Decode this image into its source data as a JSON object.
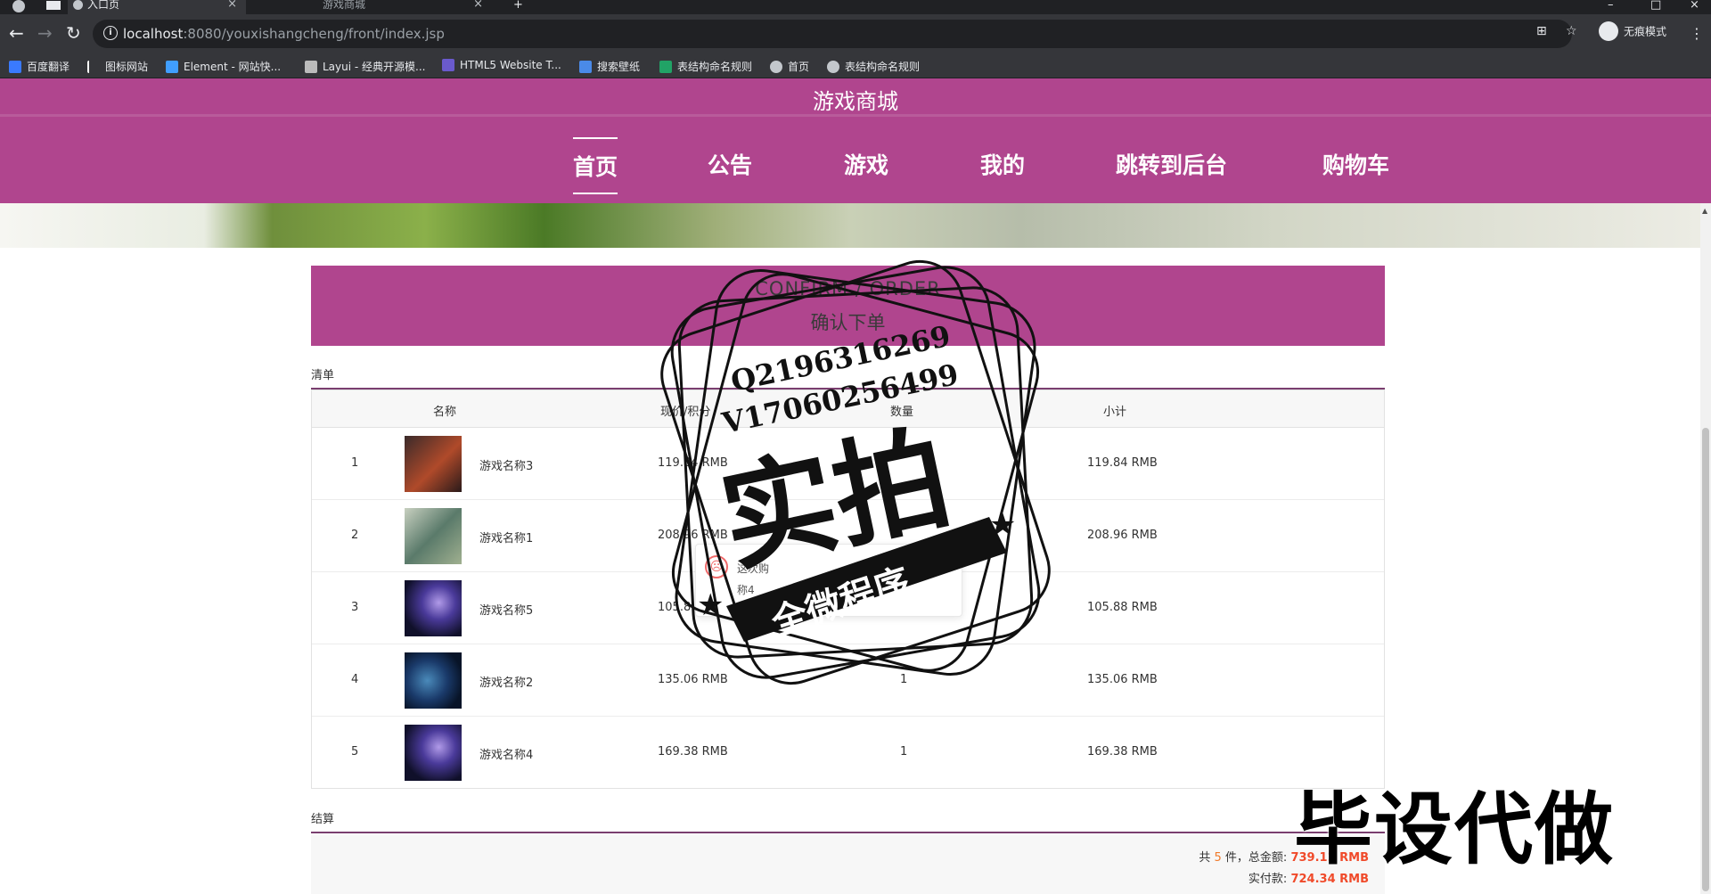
{
  "browser": {
    "tabs": [
      {
        "label": "入口页",
        "active": true
      },
      {
        "label": "游戏商城",
        "active": false
      }
    ],
    "url_host": "localhost",
    "url_rest": ":8080/youxishangcheng/front/index.jsp",
    "profile_label": "无痕模式",
    "bookmarks": [
      {
        "label": "百度翻译",
        "color": "#3a7afe"
      },
      {
        "label": "图标网站",
        "color": "#ffffff"
      },
      {
        "label": "Element - 网站快...",
        "color": "#409eff"
      },
      {
        "label": "Layui - 经典开源模...",
        "color": "#bbbbbb"
      },
      {
        "label": "HTML5 Website T...",
        "color": "#6a5acd"
      },
      {
        "label": "搜索壁纸",
        "color": "#4a8ae8"
      },
      {
        "label": "表结构命名规则",
        "color": "#21a366"
      },
      {
        "label": "首页",
        "color": "#c3c7cc"
      },
      {
        "label": "表结构命名规则",
        "color": "#c3c7cc"
      }
    ]
  },
  "site": {
    "title": "游戏商城",
    "nav": [
      {
        "label": "首页",
        "active": true
      },
      {
        "label": "公告",
        "active": false
      },
      {
        "label": "游戏",
        "active": false
      },
      {
        "label": "我的",
        "active": false
      },
      {
        "label": "跳转到后台",
        "active": false
      },
      {
        "label": "购物车",
        "active": false
      }
    ]
  },
  "order": {
    "heading_en": "CONFIRM / ORDER",
    "heading_cn": "确认下单",
    "list_label": "清单",
    "columns": [
      "名称",
      "现价/积分",
      "数量",
      "小计"
    ],
    "rows": [
      {
        "index": "1",
        "name": "游戏名称3",
        "price": "119.84 RMB",
        "qty": "",
        "subtotal": "119.84 RMB",
        "thumb": [
          "#3a2a2a",
          "#b04a2a"
        ]
      },
      {
        "index": "2",
        "name": "游戏名称1",
        "price": "208.96 RMB",
        "qty": "",
        "subtotal": "208.96 RMB",
        "thumb": [
          "#5a7a6a",
          "#c8d0c0"
        ]
      },
      {
        "index": "3",
        "name": "游戏名称5",
        "price": "105.8",
        "qty": "",
        "subtotal": "105.88 RMB",
        "thumb": [
          "#1a1a4a",
          "#8a6ad0"
        ]
      },
      {
        "index": "4",
        "name": "游戏名称2",
        "price": "135.06 RMB",
        "qty": "1",
        "subtotal": "135.06 RMB",
        "thumb": [
          "#0a1a3a",
          "#3a6a9a"
        ]
      },
      {
        "index": "5",
        "name": "游戏名称4",
        "price": "169.38 RMB",
        "qty": "1",
        "subtotal": "169.38 RMB",
        "thumb": [
          "#1a1a4a",
          "#8a6ad0"
        ]
      }
    ],
    "settle_label": "结算",
    "summary_prefix": "共",
    "summary_count": "5",
    "summary_mid": "件，总金额:",
    "summary_total": "739.12 RMB",
    "paid_label": "实付款:",
    "paid_total": "724.34 RMB"
  },
  "toast": {
    "line1": "这次购",
    "line2": "称4"
  },
  "overlay": {
    "stamp_line1": "Q2196316269",
    "stamp_line2": "V17060256499",
    "stamp_big": "实拍",
    "stamp_ribbon": "全微程序",
    "watermark": "毕设代做"
  }
}
